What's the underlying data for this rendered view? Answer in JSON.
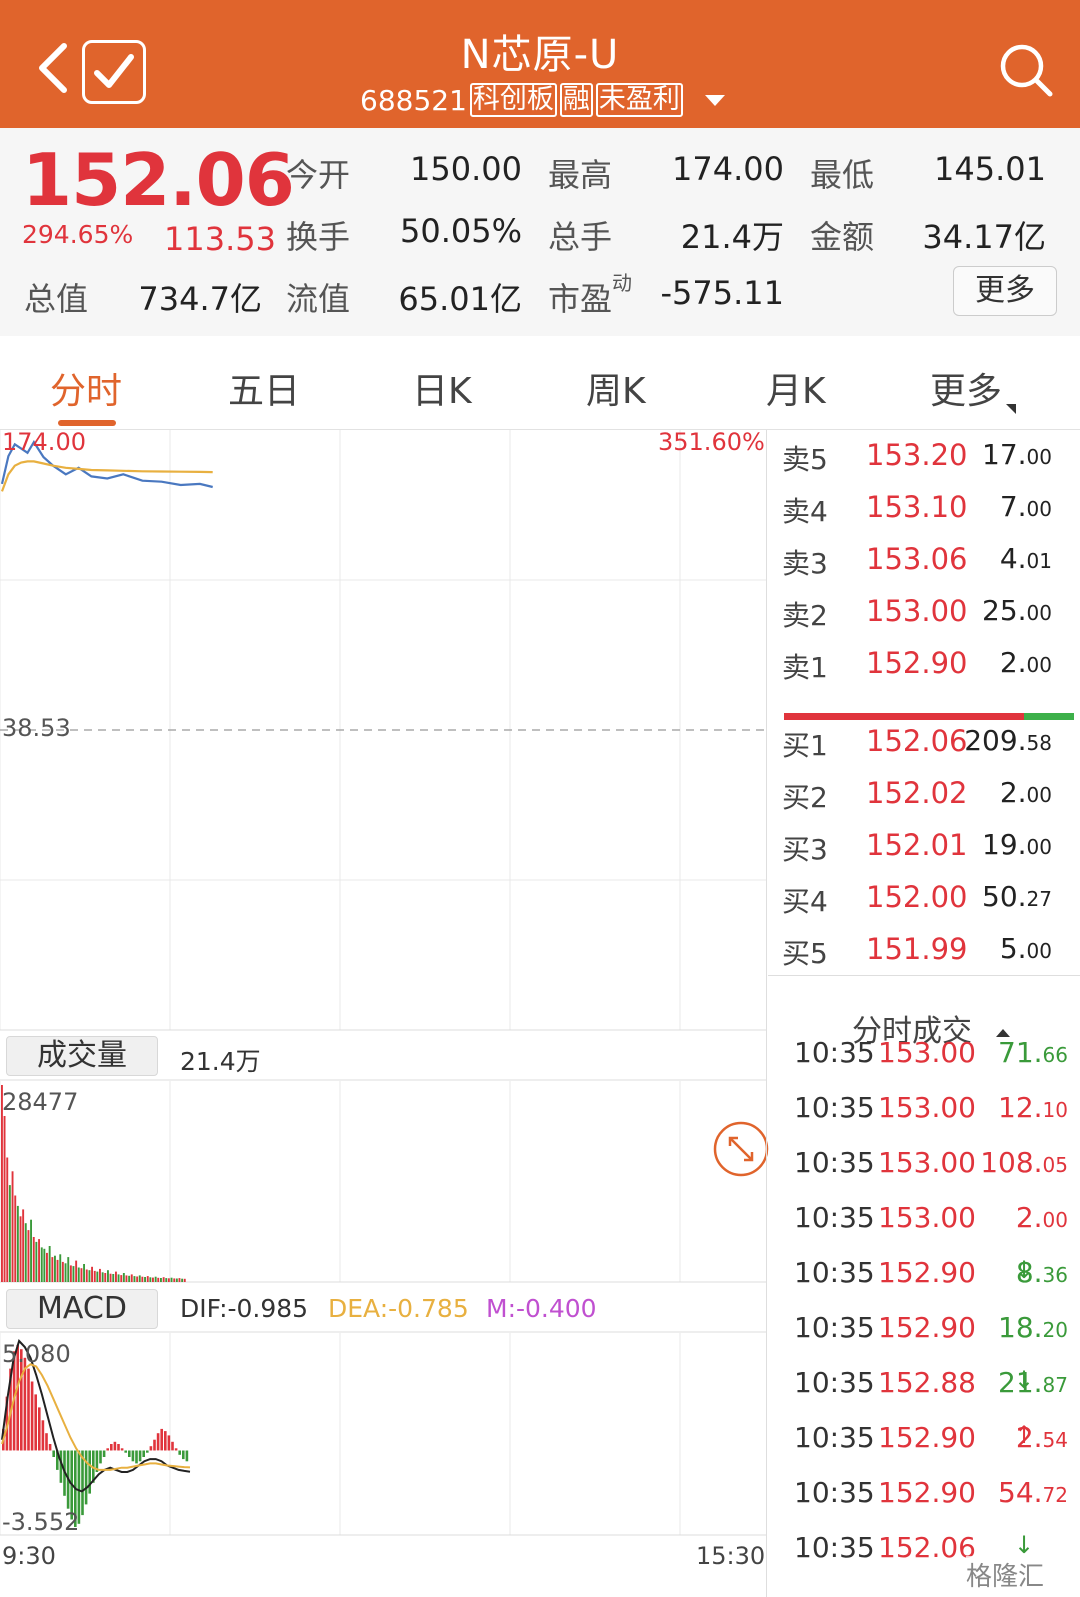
{
  "header": {
    "title": "N芯原-U",
    "code": "688521",
    "badges": [
      "科创板",
      "融",
      "未盈利"
    ]
  },
  "quote": {
    "price": "152.06",
    "change_pct": "294.65%",
    "change": "113.53",
    "fields": [
      {
        "label": "今开",
        "value": "150.00"
      },
      {
        "label": "最高",
        "value": "174.00"
      },
      {
        "label": "最低",
        "value": "145.01"
      },
      {
        "label": "换手",
        "value": "50.05%"
      },
      {
        "label": "总手",
        "value": "21.4万"
      },
      {
        "label": "金额",
        "value": "34.17亿"
      },
      {
        "label": "总值",
        "value": "734.7亿"
      },
      {
        "label": "流值",
        "value": "65.01亿"
      },
      {
        "label": "市盈",
        "value": "-575.11",
        "sup": "动"
      }
    ],
    "more_label": "更多"
  },
  "tabs": [
    "分时",
    "五日",
    "日K",
    "周K",
    "月K",
    "更多"
  ],
  "colors": {
    "accent": "#e0642c",
    "rise": "#e0343c",
    "fall": "#3a9a3a",
    "avg_line": "#e8b040",
    "price_line": "#4a78c0",
    "m_label": "#c050d0"
  },
  "order_book": {
    "asks": [
      {
        "label": "卖5",
        "price": "153.20",
        "vol_int": "17.",
        "vol_dec": "00"
      },
      {
        "label": "卖4",
        "price": "153.10",
        "vol_int": "7.",
        "vol_dec": "00"
      },
      {
        "label": "卖3",
        "price": "153.06",
        "vol_int": "4.",
        "vol_dec": "01"
      },
      {
        "label": "卖2",
        "price": "153.00",
        "vol_int": "25.",
        "vol_dec": "00"
      },
      {
        "label": "卖1",
        "price": "152.90",
        "vol_int": "2.",
        "vol_dec": "00"
      }
    ],
    "bids": [
      {
        "label": "买1",
        "price": "152.06",
        "vol_int": "209.",
        "vol_dec": "58"
      },
      {
        "label": "买2",
        "price": "152.02",
        "vol_int": "2.",
        "vol_dec": "00"
      },
      {
        "label": "买3",
        "price": "152.01",
        "vol_int": "19.",
        "vol_dec": "00"
      },
      {
        "label": "买4",
        "price": "152.00",
        "vol_int": "50.",
        "vol_dec": "27"
      },
      {
        "label": "买5",
        "price": "151.99",
        "vol_int": "5.",
        "vol_dec": "00"
      }
    ]
  },
  "ticks": {
    "heading": "分时成交",
    "rows": [
      {
        "time": "10:35",
        "price": "153.00",
        "arrow": "",
        "vol_int": "71.",
        "vol_dec": "66",
        "dir": "dn"
      },
      {
        "time": "10:35",
        "price": "153.00",
        "arrow": "",
        "vol_int": "12.",
        "vol_dec": "10",
        "dir": "up"
      },
      {
        "time": "10:35",
        "price": "153.00",
        "arrow": "",
        "vol_int": "108.",
        "vol_dec": "05",
        "dir": "up"
      },
      {
        "time": "10:35",
        "price": "153.00",
        "arrow": "",
        "vol_int": "2.",
        "vol_dec": "00",
        "dir": "up"
      },
      {
        "time": "10:35",
        "price": "152.90",
        "arrow": "↓",
        "vol_int": "8.",
        "vol_dec": "36",
        "dir": "dn"
      },
      {
        "time": "10:35",
        "price": "152.90",
        "arrow": "",
        "vol_int": "18.",
        "vol_dec": "20",
        "dir": "dn"
      },
      {
        "time": "10:35",
        "price": "152.88",
        "arrow": "↓",
        "vol_int": "21.",
        "vol_dec": "87",
        "dir": "dn"
      },
      {
        "time": "10:35",
        "price": "152.90",
        "arrow": "↑",
        "vol_int": "2.",
        "vol_dec": "54",
        "dir": "up"
      },
      {
        "time": "10:35",
        "price": "152.90",
        "arrow": "",
        "vol_int": "54.",
        "vol_dec": "72",
        "dir": "up"
      },
      {
        "time": "10:35",
        "price": "152.06",
        "arrow": "↓",
        "vol_int": "",
        "vol_dec": "",
        "dir": "up"
      }
    ]
  },
  "chart_data": [
    {
      "type": "line",
      "labels": {
        "max_price": "174.00",
        "max_pct": "351.60%",
        "pre_close": "38.53"
      },
      "ylim": [
        38.53,
        174.0
      ],
      "x_minutes_from_open": [
        0,
        2,
        4,
        6,
        8,
        10,
        13,
        16,
        20,
        24,
        28,
        33,
        38,
        44,
        50,
        56,
        62,
        66
      ],
      "series": [
        {
          "role": "price",
          "values": [
            153.5,
            166.5,
            172.0,
            170.0,
            168.0,
            173.0,
            166.0,
            162.0,
            158.0,
            161.0,
            157.0,
            156.0,
            158.0,
            155.0,
            154.5,
            153.0,
            153.5,
            152.06
          ]
        },
        {
          "role": "average",
          "values": [
            150.0,
            158.0,
            162.0,
            163.5,
            164.0,
            164.0,
            163.0,
            162.0,
            161.0,
            160.5,
            160.0,
            159.8,
            159.6,
            159.4,
            159.3,
            159.2,
            159.1,
            159.0
          ]
        }
      ],
      "x_labels": {
        "start": "9:30",
        "end": "15:30"
      }
    },
    {
      "type": "bar",
      "panel_label": "成交量",
      "total": "21.4万",
      "max_label": "28477",
      "ylim": [
        0,
        28477
      ],
      "values": [
        28477,
        24000,
        18000,
        14000,
        16000,
        12500,
        11000,
        9500,
        10500,
        8500,
        7500,
        9000,
        6500,
        5800,
        6200,
        5000,
        4800,
        4200,
        5200,
        3600,
        3800,
        3200,
        4000,
        2900,
        2700,
        3600,
        2400,
        2300,
        3100,
        2100,
        2000,
        2600,
        1800,
        1700,
        2200,
        1600,
        1500,
        1900,
        1400,
        1300,
        1700,
        1200,
        1150,
        1500,
        1100,
        1000,
        1300,
        950,
        900,
        1100,
        850,
        800,
        950,
        760,
        720,
        850,
        680,
        640,
        760,
        600,
        580,
        700,
        560,
        540,
        620,
        520,
        500,
        560,
        480,
        460
      ],
      "colors": [
        "up",
        "up",
        "up",
        "dn",
        "up",
        "up",
        "dn",
        "up",
        "up",
        "dn",
        "up",
        "dn",
        "up",
        "dn",
        "up",
        "dn",
        "dn",
        "up",
        "dn",
        "up",
        "dn",
        "up",
        "dn",
        "up",
        "dn",
        "dn",
        "up",
        "dn",
        "up",
        "dn",
        "up",
        "dn",
        "up",
        "dn",
        "up",
        "up",
        "dn",
        "up",
        "dn",
        "up",
        "dn",
        "up",
        "dn",
        "up",
        "dn",
        "up",
        "dn",
        "up",
        "dn",
        "up",
        "dn",
        "up",
        "dn",
        "up",
        "dn",
        "up",
        "dn",
        "up",
        "dn",
        "up",
        "dn",
        "up",
        "dn",
        "up",
        "dn",
        "up",
        "dn",
        "up",
        "dn",
        "up"
      ]
    },
    {
      "type": "bar",
      "panel_label": "MACD",
      "dif_label": "DIF:-0.985",
      "dea_label": "DEA:-0.785",
      "m_label": "M:-0.400",
      "max_label": "5.080",
      "min_label": "-3.552",
      "ylim": [
        -3.552,
        5.08
      ],
      "hist": [
        1.0,
        2.5,
        3.8,
        4.6,
        4.9,
        4.7,
        4.3,
        3.8,
        3.2,
        2.6,
        2.0,
        1.4,
        0.8,
        0.3,
        -0.3,
        -0.9,
        -1.5,
        -2.1,
        -2.7,
        -3.2,
        -3.55,
        -3.4,
        -3.0,
        -2.5,
        -2.0,
        -1.5,
        -1.0,
        -0.6,
        -0.3,
        0.1,
        0.3,
        0.4,
        0.3,
        0.1,
        -0.1,
        -0.3,
        -0.5,
        -0.6,
        -0.5,
        -0.3,
        -0.1,
        0.2,
        0.5,
        0.8,
        1.0,
        0.9,
        0.7,
        0.4,
        0.1,
        -0.2,
        -0.4,
        -0.5
      ],
      "dif": [
        0.5,
        2.5,
        4.2,
        5.08,
        4.8,
        4.3,
        3.5,
        2.6,
        1.6,
        0.6,
        -0.3,
        -1.0,
        -1.5,
        -1.8,
        -1.9,
        -1.7,
        -1.4,
        -1.1,
        -0.9,
        -0.8,
        -0.9,
        -1.0,
        -1.0,
        -0.9,
        -0.7,
        -0.5,
        -0.4,
        -0.4,
        -0.5,
        -0.7,
        -0.8,
        -0.9,
        -0.95,
        -0.985
      ],
      "dea": [
        0.3,
        1.2,
        2.3,
        3.2,
        3.8,
        4.0,
        3.9,
        3.5,
        3.0,
        2.4,
        1.8,
        1.2,
        0.6,
        0.1,
        -0.3,
        -0.6,
        -0.8,
        -0.9,
        -0.9,
        -0.9,
        -0.85,
        -0.8,
        -0.8,
        -0.75,
        -0.7,
        -0.65,
        -0.6,
        -0.6,
        -0.65,
        -0.7,
        -0.72,
        -0.75,
        -0.77,
        -0.785
      ]
    }
  ],
  "watermark": "格隆汇"
}
